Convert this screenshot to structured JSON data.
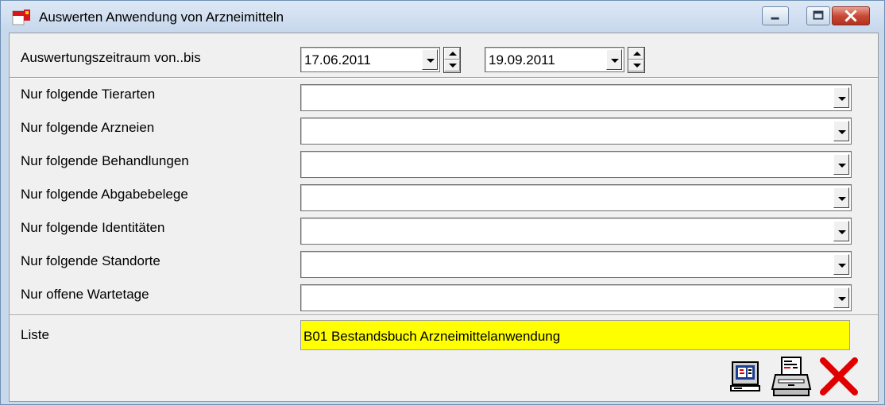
{
  "window": {
    "title": "Auswerten Anwendung von Arzneimitteln"
  },
  "period": {
    "label": "Auswertungszeitraum von..bis",
    "from": "17.06.2011",
    "to": "19.09.2011"
  },
  "filters": [
    {
      "label": "Nur folgende Tierarten",
      "value": ""
    },
    {
      "label": "Nur folgende Arzneien",
      "value": ""
    },
    {
      "label": "Nur folgende Behandlungen",
      "value": ""
    },
    {
      "label": "Nur folgende Abgabebelege",
      "value": ""
    },
    {
      "label": "Nur folgende Identitäten",
      "value": ""
    },
    {
      "label": "Nur folgende Standorte",
      "value": ""
    },
    {
      "label": "Nur offene Wartetage",
      "value": ""
    }
  ],
  "liste": {
    "label": "Liste",
    "value": "B01 Bestandsbuch Arzneimittelanwendung",
    "highlight_color": "#ffff00"
  },
  "toolbar": {
    "icons": [
      "screen-preview-icon",
      "printer-icon",
      "close-x-icon"
    ],
    "close_color": "#e00000"
  }
}
